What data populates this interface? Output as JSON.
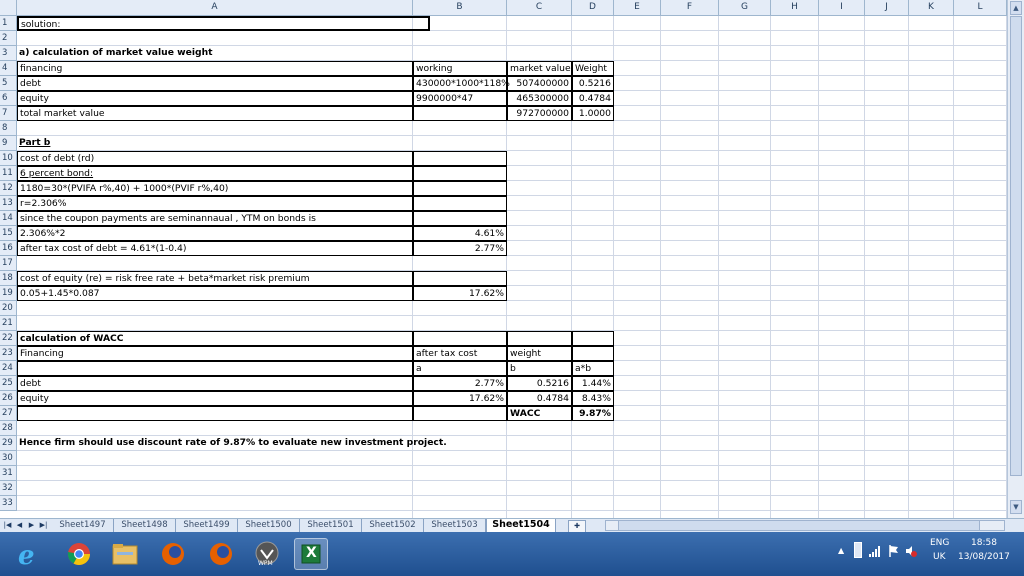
{
  "columns": [
    "A",
    "B",
    "C",
    "D",
    "E",
    "F",
    "G",
    "H",
    "I",
    "J",
    "K",
    "L"
  ],
  "rows": [
    "1",
    "2",
    "3",
    "4",
    "5",
    "6",
    "7",
    "8",
    "9",
    "10",
    "11",
    "12",
    "13",
    "14",
    "15",
    "16",
    "17",
    "18",
    "19",
    "20",
    "21",
    "22",
    "23",
    "24",
    "25",
    "26",
    "27",
    "28",
    "29",
    "30",
    "31",
    "32",
    "33"
  ],
  "cells": {
    "A1": "solution:",
    "A3": "a) calculation of market value weight",
    "A4": "financing",
    "B4": "working",
    "C4": "market value",
    "D4": "Weight",
    "A5": "debt",
    "B5": "430000*1000*118%",
    "C5": "507400000",
    "D5": "0.5216",
    "A6": "equity",
    "B6": "9900000*47",
    "C6": "465300000",
    "D6": "0.4784",
    "A7": "total market value",
    "C7": "972700000",
    "D7": "1.0000",
    "A9": "Part b",
    "A10": "cost of debt (rd)",
    "A11": "6 percent bond:",
    "A12": "1180=30*(PVIFA r%,40) + 1000*(PVIF r%,40)",
    "A13": "r=2.306%",
    "A14": "since the coupon payments are seminannaual , YTM on bonds is",
    "A15": "2.306%*2",
    "B15": "4.61%",
    "A16": "after tax cost of debt = 4.61*(1-0.4)",
    "B16": "2.77%",
    "A18": "cost of equity (re) = risk free rate + beta*market risk premium",
    "A19": "0.05+1.45*0.087",
    "B19": "17.62%",
    "A22": "calculation of WACC",
    "A23": "Financing",
    "B23": "after tax cost",
    "C23": "weight",
    "B24": "a",
    "C24": "b",
    "D24": "a*b",
    "A25": "debt",
    "B25": "2.77%",
    "C25": "0.5216",
    "D25": "1.44%",
    "A26": "equity",
    "B26": "17.62%",
    "C26": "0.4784",
    "D26": "8.43%",
    "C27": "WACC",
    "D27": "9.87%",
    "A29": "Hence firm should use discount rate of 9.87% to evaluate new investment project."
  },
  "sheet_tabs": [
    "Sheet1497",
    "Sheet1498",
    "Sheet1499",
    "Sheet1500",
    "Sheet1501",
    "Sheet1502",
    "Sheet1503",
    "Sheet1504"
  ],
  "active_sheet": "Sheet1504",
  "taskbar": {
    "apps": [
      "internet-explorer-icon",
      "chrome-icon",
      "file-explorer-icon",
      "firefox-icon",
      "firefox-icon",
      "wpm-icon",
      "excel-icon"
    ],
    "wpm_label": "WPM",
    "excel_label": "X",
    "language": "ENG",
    "region": "UK",
    "time": "18:58",
    "date": "13/08/2017"
  },
  "colors": {
    "header_bg": "#e4ecf7",
    "grid_line": "#d0d7e5",
    "taskbar": "#2a5c9e"
  }
}
